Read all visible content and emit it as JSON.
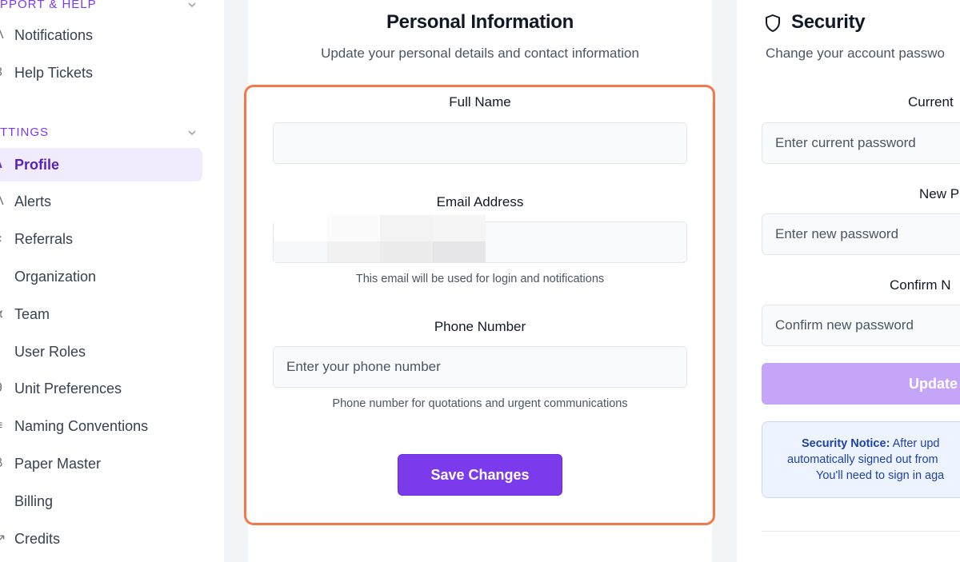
{
  "sidebar": {
    "support_header": "PPORT & HELP",
    "support_items": [
      {
        "icon": "bell-icon",
        "glyph": "Λ",
        "label": "Notifications"
      },
      {
        "icon": "ticket-icon",
        "glyph": "3",
        "label": "Help Tickets"
      }
    ],
    "settings_header": "TTINGS",
    "settings_items": [
      {
        "icon": "user-icon",
        "glyph": "λ",
        "label": "Profile",
        "active": true
      },
      {
        "icon": "alert-icon",
        "glyph": "Λ",
        "label": "Alerts"
      },
      {
        "icon": "share-icon",
        "glyph": "ϲ",
        "label": "Referrals"
      },
      {
        "icon": "building-icon",
        "glyph": "]",
        "label": "Organization"
      },
      {
        "icon": "team-icon",
        "glyph": "ϰ",
        "label": "Team"
      },
      {
        "icon": "shield-user-icon",
        "glyph": ")",
        "label": "User Roles"
      },
      {
        "icon": "globe-icon",
        "glyph": "θ",
        "label": "Unit Preferences"
      },
      {
        "icon": "list-icon",
        "glyph": "≡",
        "label": "Naming Conventions"
      },
      {
        "icon": "file-icon",
        "glyph": "β",
        "label": "Paper Master"
      },
      {
        "icon": "billing-icon",
        "glyph": "]",
        "label": "Billing"
      },
      {
        "icon": "credits-icon",
        "glyph": "↗",
        "label": "Credits"
      }
    ]
  },
  "personal": {
    "title": "Personal Information",
    "subtitle": "Update your personal details and contact information",
    "full_name_label": "Full Name",
    "full_name_value": "",
    "email_label": "Email Address",
    "email_value": "",
    "email_helper": "This email will be used for login and notifications",
    "phone_label": "Phone Number",
    "phone_placeholder": "Enter your phone number",
    "phone_helper": "Phone number for quotations and urgent communications",
    "save_label": "Save Changes"
  },
  "security": {
    "title": "Security",
    "subtitle": "Change your account passwo",
    "current_label": "Current",
    "current_placeholder": "Enter current password",
    "new_label": "New P",
    "new_placeholder": "Enter new password",
    "confirm_label": "Confirm N",
    "confirm_placeholder": "Confirm new password",
    "update_label": "Update",
    "notice_bold": "Security Notice:",
    "notice_line1_rest": " After upd",
    "notice_line2": "automatically signed out from",
    "notice_line3": "You'll need to sign in aga"
  },
  "colors": {
    "accent": "#7c3aed",
    "highlight_border": "#f07a4a",
    "notice_text": "#1e40af",
    "update_button": "#c4a5f7"
  }
}
